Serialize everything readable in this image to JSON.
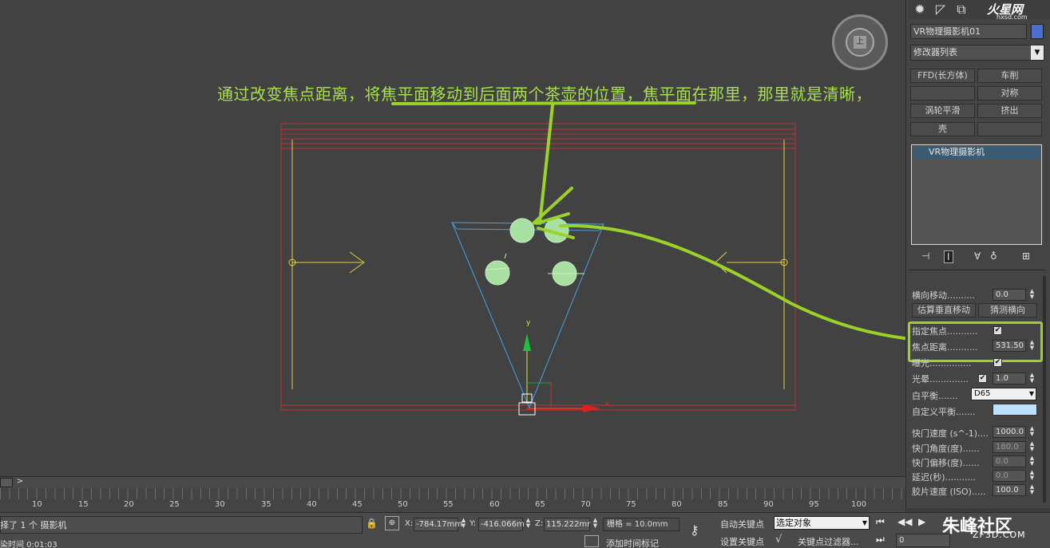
{
  "viewport": {
    "annotation_before": "通过改变焦点距离，",
    "annotation_underlined": "将焦平面移动到后面两个茶壶的位置",
    "annotation_after": "，焦平面在那里，那里就是清晰，",
    "nav_cube_face": "上",
    "axis_y": "y",
    "axis_x": "x"
  },
  "watermark_top": {
    "logo": "火星网",
    "url": "hxsd.com"
  },
  "command_panel": {
    "object_name": "VR物理摄影机01",
    "object_color": "#4a6fd0",
    "modifier_list": "修改器列表",
    "modifier_buttons": [
      "FFD(长方体)",
      "车削",
      "",
      "对称",
      "涡轮平滑",
      "挤出",
      "壳",
      ""
    ],
    "stack_item": "VR物理摄影机",
    "params": {
      "lateral_shift_label": "横向移动",
      "lateral_shift_dots": "..........",
      "lateral_shift_value": "0.0",
      "guess_vertical_btn": "估算垂直移动",
      "guess_lateral_btn": "猜测横向",
      "specify_focus_label": "指定焦点",
      "specify_focus_dots": "...........",
      "focus_distance_label": "焦点距离",
      "focus_distance_dots": "...........",
      "focus_distance_value": "531.50",
      "exposure_label": "曝光",
      "exposure_dots": "...............",
      "vignetting_label": "光晕",
      "vignetting_dots": "..............",
      "vignetting_value": "1.0",
      "white_balance_label": "白平衡",
      "white_balance_dots": ".......",
      "white_balance_value": "D65",
      "custom_balance_label": "自定义平衡",
      "custom_balance_dots": ".......",
      "custom_balance_color": "#bde0ff",
      "shutter_speed_label": "快门速度 (s^-1)",
      "shutter_speed_dots": "....",
      "shutter_speed_value": "1000.0",
      "shutter_angle_label": "快门角度(度)",
      "shutter_angle_dots": "......",
      "shutter_angle_value": "180.0",
      "shutter_offset_label": "快门偏移(度)",
      "shutter_offset_dots": "......",
      "shutter_offset_value": "0.0",
      "latency_label": "延迟(秒)",
      "latency_dots": "...........",
      "latency_value": "0.0",
      "iso_label": "胶片速度 (ISO)",
      "iso_dots": ".....",
      "iso_value": "100.0"
    },
    "highlight_color": "#9ad22a"
  },
  "timeline": {
    "next_label": ">",
    "ticks": [
      "10",
      "15",
      "20",
      "25",
      "30",
      "35",
      "40",
      "45",
      "50",
      "55",
      "60",
      "65",
      "70",
      "75",
      "80",
      "85",
      "90",
      "95",
      "100"
    ]
  },
  "status": {
    "selection": "择了 1 个 摄影机",
    "render_time": "染时间  0:01:03",
    "x_label": "X:",
    "x_value": "-784.17mm",
    "y_label": "Y:",
    "y_value": "-416.066m",
    "z_label": "Z:",
    "z_value": "115.222mr",
    "grid": "栅格 = 10.0mm",
    "auto_key": "自动关键点",
    "set_key": "设置关键点",
    "selection_set": "选定对象",
    "key_filters": "关键点过滤器...",
    "add_time_tag": "添加时间标记",
    "frame": "0"
  },
  "watermark_bottom": {
    "text": "朱峰社区",
    "url": "ZF3D.COM"
  }
}
